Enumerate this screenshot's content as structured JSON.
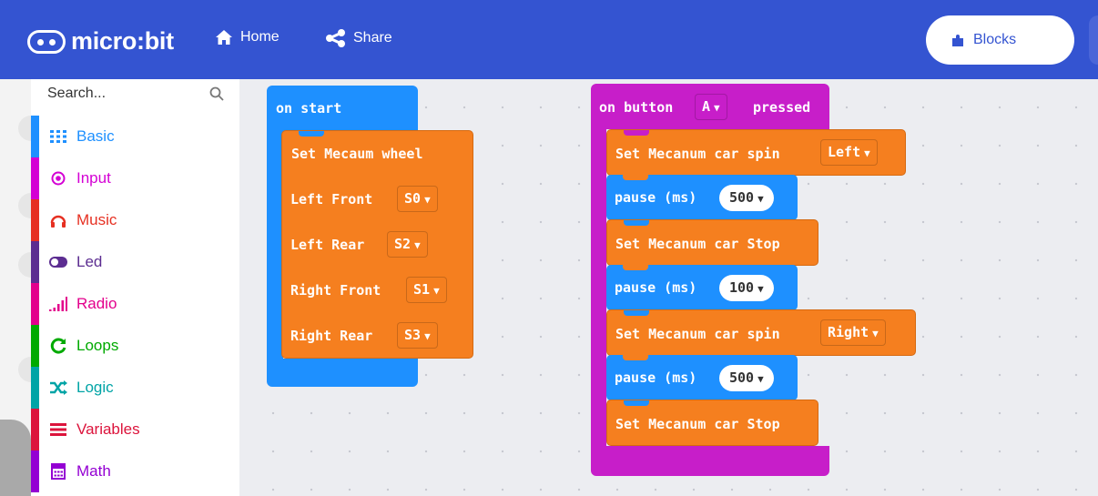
{
  "header": {
    "logo_text": "micro:bit",
    "home_label": "Home",
    "share_label": "Share",
    "blocks_label": "Blocks"
  },
  "sidebar": {
    "search_placeholder": "Search...",
    "categories": [
      {
        "label": "Basic",
        "color": "#1e90ff",
        "icon": "grid-icon"
      },
      {
        "label": "Input",
        "color": "#d400d4",
        "icon": "target-icon"
      },
      {
        "label": "Music",
        "color": "#e63022",
        "icon": "headphones-icon"
      },
      {
        "label": "Led",
        "color": "#5c2d91",
        "icon": "toggle-icon"
      },
      {
        "label": "Radio",
        "color": "#e3008c",
        "icon": "signal-icon"
      },
      {
        "label": "Loops",
        "color": "#00aa00",
        "icon": "refresh-icon"
      },
      {
        "label": "Logic",
        "color": "#00a4a6",
        "icon": "shuffle-icon"
      },
      {
        "label": "Variables",
        "color": "#dc143c",
        "icon": "list-icon"
      },
      {
        "label": "Math",
        "color": "#9400d3",
        "icon": "calculator-icon"
      }
    ]
  },
  "workspace": {
    "on_start": {
      "hat_label": "on start",
      "set_wheel_label": "Set Mecaum wheel",
      "rows": [
        {
          "label": "Left Front",
          "value": "S0"
        },
        {
          "label": "Left Rear",
          "value": "S2"
        },
        {
          "label": "Right Front",
          "value": "S1"
        },
        {
          "label": "Right Rear",
          "value": "S3"
        }
      ]
    },
    "on_button": {
      "prefix": "on button",
      "button": "A",
      "suffix": "pressed",
      "statements": [
        {
          "label": "Set Mecanum car spin",
          "value": "Left"
        },
        {
          "label": "pause (ms)",
          "value": "500"
        },
        {
          "label": "Set Mecanum car Stop"
        },
        {
          "label": "pause (ms)",
          "value": "100"
        },
        {
          "label": "Set Mecanum car spin",
          "value": "Right"
        },
        {
          "label": "pause (ms)",
          "value": "500"
        },
        {
          "label": "Set Mecanum car Stop"
        }
      ]
    }
  },
  "colors": {
    "header": "#3454d1",
    "basic_block": "#1e90ff",
    "motor_block": "#f57f1f",
    "input_block": "#c71ec9"
  }
}
